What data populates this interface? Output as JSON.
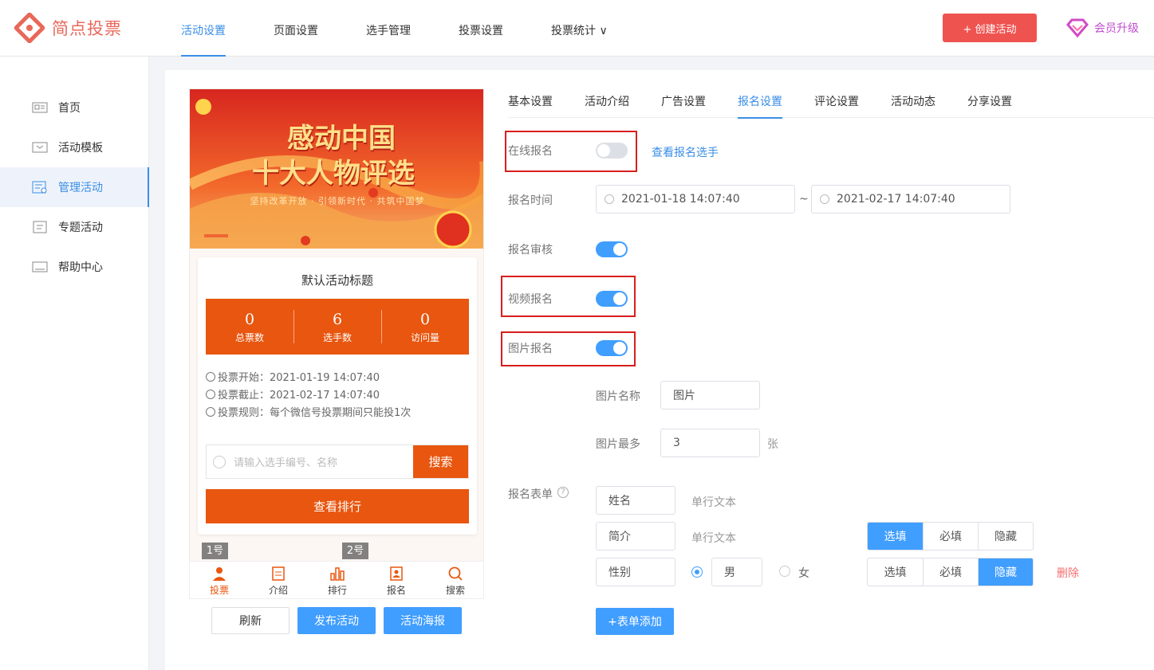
{
  "app": {
    "logo_text": "简点投票",
    "create_label": "+ 创建活动",
    "upgrade_label": "会员升级"
  },
  "topnav": [
    {
      "label": "活动设置",
      "active": true
    },
    {
      "label": "页面设置"
    },
    {
      "label": "选手管理"
    },
    {
      "label": "投票设置"
    },
    {
      "label": "投票统计 ∨"
    }
  ],
  "sidebar": [
    {
      "label": "首页",
      "icon": "id-card-icon"
    },
    {
      "label": "活动模板",
      "icon": "inbox-icon"
    },
    {
      "label": "管理活动",
      "icon": "manage-list-icon",
      "active": true
    },
    {
      "label": "专题活动",
      "icon": "document-icon"
    },
    {
      "label": "帮助中心",
      "icon": "book-icon"
    }
  ],
  "preview": {
    "banner_title_1": "感动中国",
    "banner_title_2": "十大人物评选",
    "banner_sub": "坚持改革开放 · 引领新时代 · 共筑中国梦",
    "card_title": "默认活动标题",
    "stats": [
      {
        "num": "0",
        "label": "总票数"
      },
      {
        "num": "6",
        "label": "选手数"
      },
      {
        "num": "0",
        "label": "访问量"
      }
    ],
    "info": [
      "投票开始：2021-01-19 14:07:40",
      "投票截止：2021-02-17 14:07:40",
      "投票规则：每个微信号投票期间只能投1次"
    ],
    "search_placeholder": "请输入选手编号、名称",
    "search_btn": "搜索",
    "rank_btn": "查看排行",
    "tag1": "1号",
    "tag2": "2号",
    "tabbar": [
      {
        "label": "投票",
        "icon": "user-icon",
        "active": true
      },
      {
        "label": "介绍",
        "icon": "doc-icon"
      },
      {
        "label": "排行",
        "icon": "bar-chart-icon"
      },
      {
        "label": "报名",
        "icon": "signup-icon"
      },
      {
        "label": "搜索",
        "icon": "search-icon"
      }
    ],
    "buttons": {
      "refresh": "刷新",
      "publish": "发布活动",
      "poster": "活动海报"
    }
  },
  "settings_tabs": [
    {
      "label": "基本设置"
    },
    {
      "label": "活动介绍"
    },
    {
      "label": "广告设置"
    },
    {
      "label": "报名设置",
      "active": true
    },
    {
      "label": "评论设置"
    },
    {
      "label": "活动动态"
    },
    {
      "label": "分享设置"
    }
  ],
  "form": {
    "online_signup": {
      "label": "在线报名",
      "on": false,
      "link": "查看报名选手"
    },
    "signup_time": {
      "label": "报名时间",
      "start": "2021-01-18 14:07:40",
      "sep": "~",
      "end": "2021-02-17 14:07:40"
    },
    "review": {
      "label": "报名审核",
      "on": true
    },
    "video": {
      "label": "视频报名",
      "on": true
    },
    "image": {
      "label": "图片报名",
      "on": true
    },
    "image_name": {
      "label": "图片名称",
      "value": "图片"
    },
    "image_max": {
      "label": "图片最多",
      "value": "3",
      "unit": "张"
    },
    "form_fields": {
      "label": "报名表单",
      "rows": [
        {
          "name": "姓名",
          "type": "单行文本"
        },
        {
          "name": "简介",
          "type": "单行文本",
          "options": [
            "选填",
            "必填",
            "隐藏"
          ],
          "selected": 0
        },
        {
          "name": "性别",
          "radio_male": "男",
          "radio_female": "女",
          "options": [
            "选填",
            "必填",
            "隐藏"
          ],
          "selected": 2,
          "delete": "删除"
        }
      ],
      "add_btn": "+表单添加"
    }
  },
  "colors": {
    "accent": "#409eff",
    "brand_orange": "#e8560f",
    "danger": "#ef5350",
    "highlight_box": "#d81e1e"
  }
}
